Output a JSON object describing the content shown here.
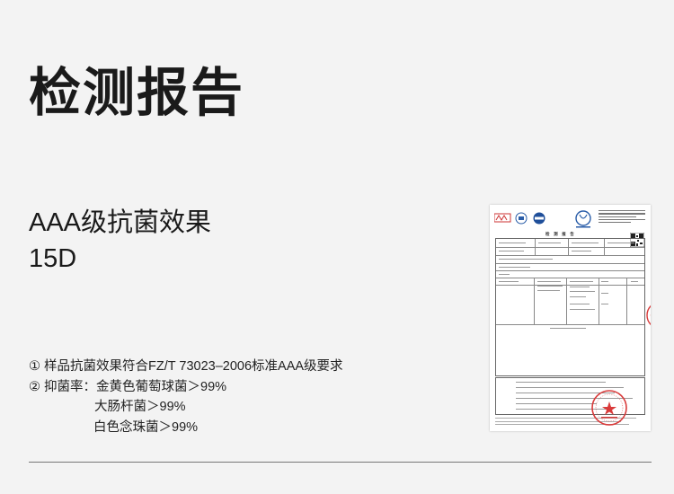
{
  "page": {
    "title": "检测报告",
    "subtitle_line1": "AAA级抗菌效果",
    "subtitle_line2": "15D",
    "notes": {
      "note1": "① 样品抗菌效果符合FZ/T 73023–2006标准AAA级要求",
      "note2_label": "② 抑菌率：",
      "note2_item1": "金黄色葡萄球菌＞99%",
      "note2_item2": "大肠杆菌＞99%",
      "note2_item3": "白色念珠菌＞99%"
    }
  },
  "report_image": {
    "heading": "检 测 报 告"
  },
  "colors": {
    "background": "#f3f3f3",
    "text": "#1a1a1a",
    "stamp_red": "#d93a3a",
    "divider": "#777777"
  }
}
